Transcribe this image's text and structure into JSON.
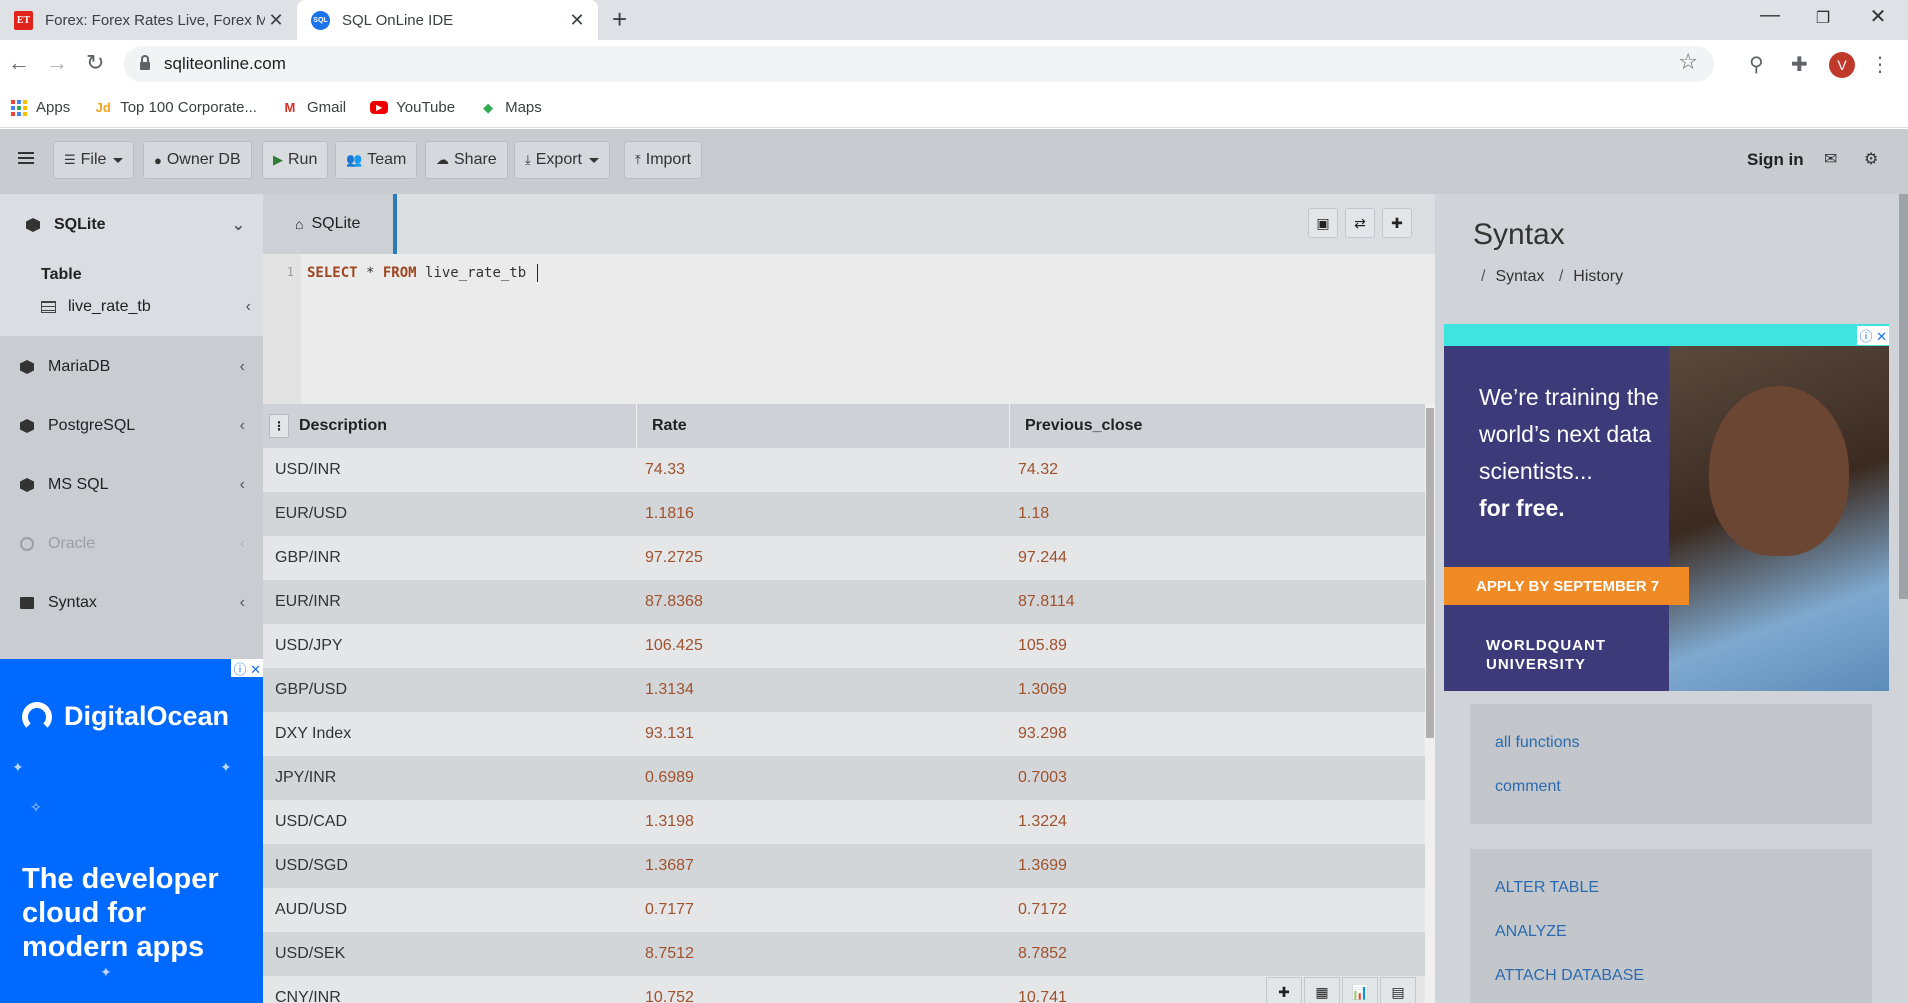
{
  "browser": {
    "tabs": [
      {
        "title": "Forex: Forex Rates Live, Forex Ma",
        "favicon": "ET"
      },
      {
        "title": "SQL OnLine IDE",
        "favicon": "SQL"
      }
    ],
    "url": "sqliteonline.com",
    "avatar_letter": "V",
    "bookmarks": [
      "Apps",
      "Top 100 Corporate...",
      "Gmail",
      "YouTube",
      "Maps"
    ]
  },
  "toolbar": {
    "file": "File",
    "owner_db": "Owner DB",
    "run": "Run",
    "team": "Team",
    "share": "Share",
    "export": "Export",
    "import": "Import",
    "sign_in": "Sign in"
  },
  "sidebar": {
    "active_db": "SQLite",
    "table_heading": "Table",
    "table_item": "live_rate_tb",
    "databases": [
      "MariaDB",
      "PostgreSQL",
      "MS SQL",
      "Oracle",
      "Syntax"
    ]
  },
  "ad_left": {
    "brand": "DigitalOcean",
    "tagline": "The developer cloud for modern apps"
  },
  "editor": {
    "tab": "SQLite",
    "line_number": "1",
    "kw_select": "SELECT",
    "star": " * ",
    "kw_from": "FROM",
    "table": " live_rate_tb "
  },
  "result": {
    "columns": [
      "Description",
      "Rate",
      "Previous_close"
    ],
    "rows": [
      [
        "USD/INR",
        "74.33",
        "74.32"
      ],
      [
        "EUR/USD",
        "1.1816",
        "1.18"
      ],
      [
        "GBP/INR",
        "97.2725",
        "97.244"
      ],
      [
        "EUR/INR",
        "87.8368",
        "87.8114"
      ],
      [
        "USD/JPY",
        "106.425",
        "105.89"
      ],
      [
        "GBP/USD",
        "1.3134",
        "1.3069"
      ],
      [
        "DXY Index",
        "93.131",
        "93.298"
      ],
      [
        "JPY/INR",
        "0.6989",
        "0.7003"
      ],
      [
        "USD/CAD",
        "1.3198",
        "1.3224"
      ],
      [
        "USD/SGD",
        "1.3687",
        "1.3699"
      ],
      [
        "AUD/USD",
        "0.7177",
        "0.7172"
      ],
      [
        "USD/SEK",
        "8.7512",
        "8.7852"
      ],
      [
        "CNY/INR",
        "10.752",
        "10.741"
      ]
    ]
  },
  "rpanel": {
    "title": "Syntax",
    "crumb_syntax": "Syntax",
    "crumb_history": "History",
    "ad_line1": "We’re training the world’s next data scientists...",
    "ad_line2": "for free.",
    "ad_apply": "APPLY BY SEPTEMBER 7",
    "ad_logo1": "WORLDQUANT",
    "ad_logo2": "UNIVERSITY",
    "links1": [
      "all functions",
      "comment"
    ],
    "links2": [
      "ALTER TABLE",
      "ANALYZE",
      "ATTACH DATABASE"
    ]
  },
  "colors": {
    "accent": "#2c7bb6",
    "value_text": "#a0522d",
    "link": "#2a6bb0",
    "toolbar_bg": "#c8ccd1"
  }
}
